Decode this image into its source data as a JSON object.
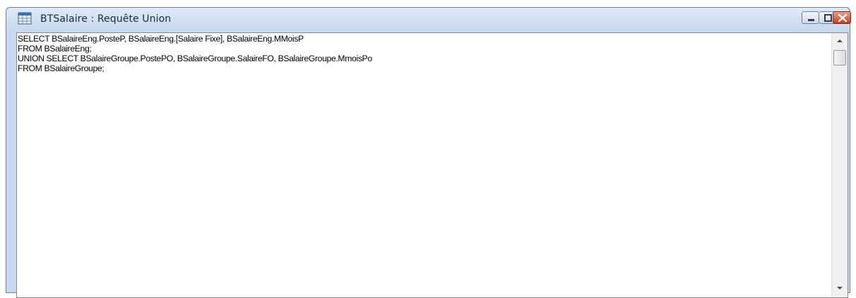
{
  "window": {
    "title": "BTSalaire : Requête Union",
    "icon": "query-grid-icon"
  },
  "controls": {
    "minimize": "minimize-icon",
    "maximize": "maximize-icon",
    "close": "close-icon"
  },
  "editor": {
    "lines": [
      "SELECT BSalaireEng.PosteP, BSalaireEng.[Salaire Fixe], BSalaireEng.MMoisP",
      "FROM BSalaireEng;",
      "UNION SELECT BSalaireGroupe.PostePO, BSalaireGroupe.SalaireFO, BSalaireGroupe.MmoisPo",
      "FROM BSalaireGroupe;"
    ]
  },
  "colors": {
    "frame": "#c6d9ee",
    "close_button": "#c43c1f"
  }
}
